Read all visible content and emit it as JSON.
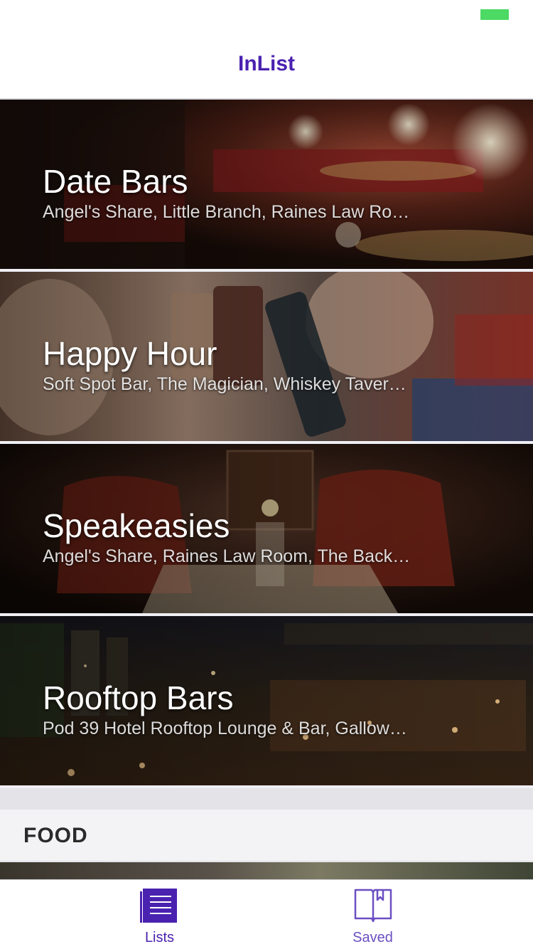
{
  "app": {
    "title": "InList",
    "accent_color": "#4a22b0",
    "battery_color": "#4cd964"
  },
  "lists": [
    {
      "title": "Date Bars",
      "subtitle": "Angel's Share, Little Branch, Raines Law Ro…",
      "image": "dim-lounge-red-booths"
    },
    {
      "title": "Happy Hour",
      "subtitle": "Soft Spot Bar, The Magician, Whiskey Taver…",
      "image": "friends-toasting-drinks"
    },
    {
      "title": "Speakeasies",
      "subtitle": "Angel's Share, Raines Law Room, The Back…",
      "image": "brick-fireplace-red-chairs"
    },
    {
      "title": "Rooftop Bars",
      "subtitle": "Pod 39 Hotel Rooftop Lounge & Bar, Gallow…",
      "image": "night-rooftop-city-lights"
    }
  ],
  "section": {
    "title": "FOOD"
  },
  "tabs": [
    {
      "label": "Lists",
      "icon": "list-icon",
      "active": true
    },
    {
      "label": "Saved",
      "icon": "book-bookmark-icon",
      "active": false
    }
  ]
}
